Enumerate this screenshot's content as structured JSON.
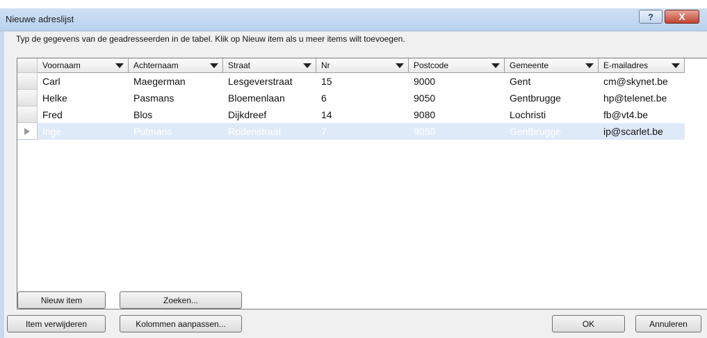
{
  "window": {
    "title": "Nieuwe adreslijst",
    "help_label": "?",
    "close_label": "X"
  },
  "instruction": "Typ de gegevens van de geadresseerden in de tabel. Klik op Nieuw item als u meer items wilt toevoegen.",
  "table": {
    "columns": [
      "Voornaam",
      "Achternaam",
      "Straat",
      "Nr",
      "Postcode",
      "Gemeente",
      "E-mailadres"
    ],
    "rows": [
      [
        "Carl",
        "Maegerman",
        "Lesgeverstraat",
        "15",
        "9000",
        "Gent",
        "cm@skynet.be"
      ],
      [
        "Helke",
        "Pasmans",
        "Bloemenlaan",
        "6",
        "9050",
        "Gentbrugge",
        "hp@telenet.be"
      ],
      [
        "Fred",
        "Blos",
        "Dijkdreef",
        "14",
        "9080",
        "Lochristi",
        "fb@vt4.be"
      ],
      [
        "Inge",
        "Putmans",
        "Rodenstraat",
        "7",
        "9050",
        "Gentbrugge",
        "ip@scarlet.be"
      ]
    ],
    "selected_row": 3
  },
  "buttons": {
    "new_item": "Nieuw item",
    "find": "Zoeken...",
    "delete_item": "Item verwijderen",
    "customize_columns": "Kolommen aanpassen...",
    "ok": "OK",
    "cancel": "Annuleren"
  },
  "colors": {
    "selected_row_bg": "#dfeaf9",
    "titlebar": "#c4d8f1",
    "close_button": "#c0442f"
  }
}
